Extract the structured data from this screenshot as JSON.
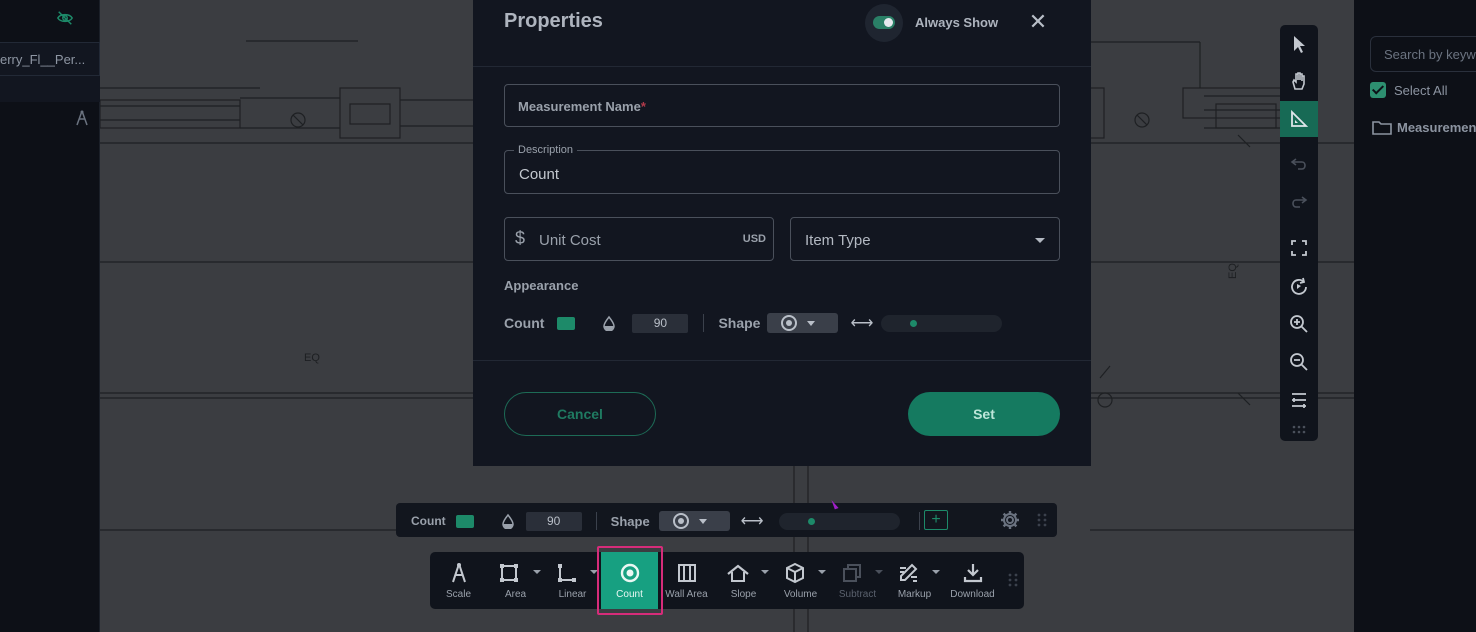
{
  "left_panel": {
    "file_name": "erry_Fl__Per..."
  },
  "right_panel": {
    "search_placeholder": "Search by keyw",
    "select_all": "Select All",
    "folder": "Measuremen"
  },
  "canvas": {
    "eq_label_1": "EQ",
    "eq_label_2": "EQ"
  },
  "modal": {
    "title": "Properties",
    "always_show_label": "Always Show",
    "always_show_on": true,
    "close_glyph": "✕",
    "measurement_name_placeholder": "Measurement Name",
    "required_mark": "*",
    "description_label": "Description",
    "description_value": "Count",
    "currency_symbol": "$",
    "unit_cost_placeholder": "Unit Cost",
    "currency": "USD",
    "item_type_placeholder": "Item Type",
    "appearance_heading": "Appearance",
    "appearance": {
      "label": "Count",
      "color": "#1d8a69",
      "opacity": "90",
      "shape_label": "Shape",
      "size_level": 0.25
    },
    "cancel_label": "Cancel",
    "set_label": "Set"
  },
  "count_bar": {
    "label": "Count",
    "opacity": "90",
    "shape_label": "Shape",
    "add_glyph": "+",
    "size_level": 0.25
  },
  "bottom_toolbar": {
    "tools": [
      {
        "label": "Scale"
      },
      {
        "label": "Area"
      },
      {
        "label": "Linear"
      },
      {
        "label": "Count"
      },
      {
        "label": "Wall Area"
      },
      {
        "label": "Slope"
      },
      {
        "label": "Volume"
      },
      {
        "label": "Subtract"
      },
      {
        "label": "Markup"
      },
      {
        "label": "Download"
      }
    ]
  },
  "colors": {
    "accent": "#17a081",
    "highlight": "#d62c7a"
  }
}
